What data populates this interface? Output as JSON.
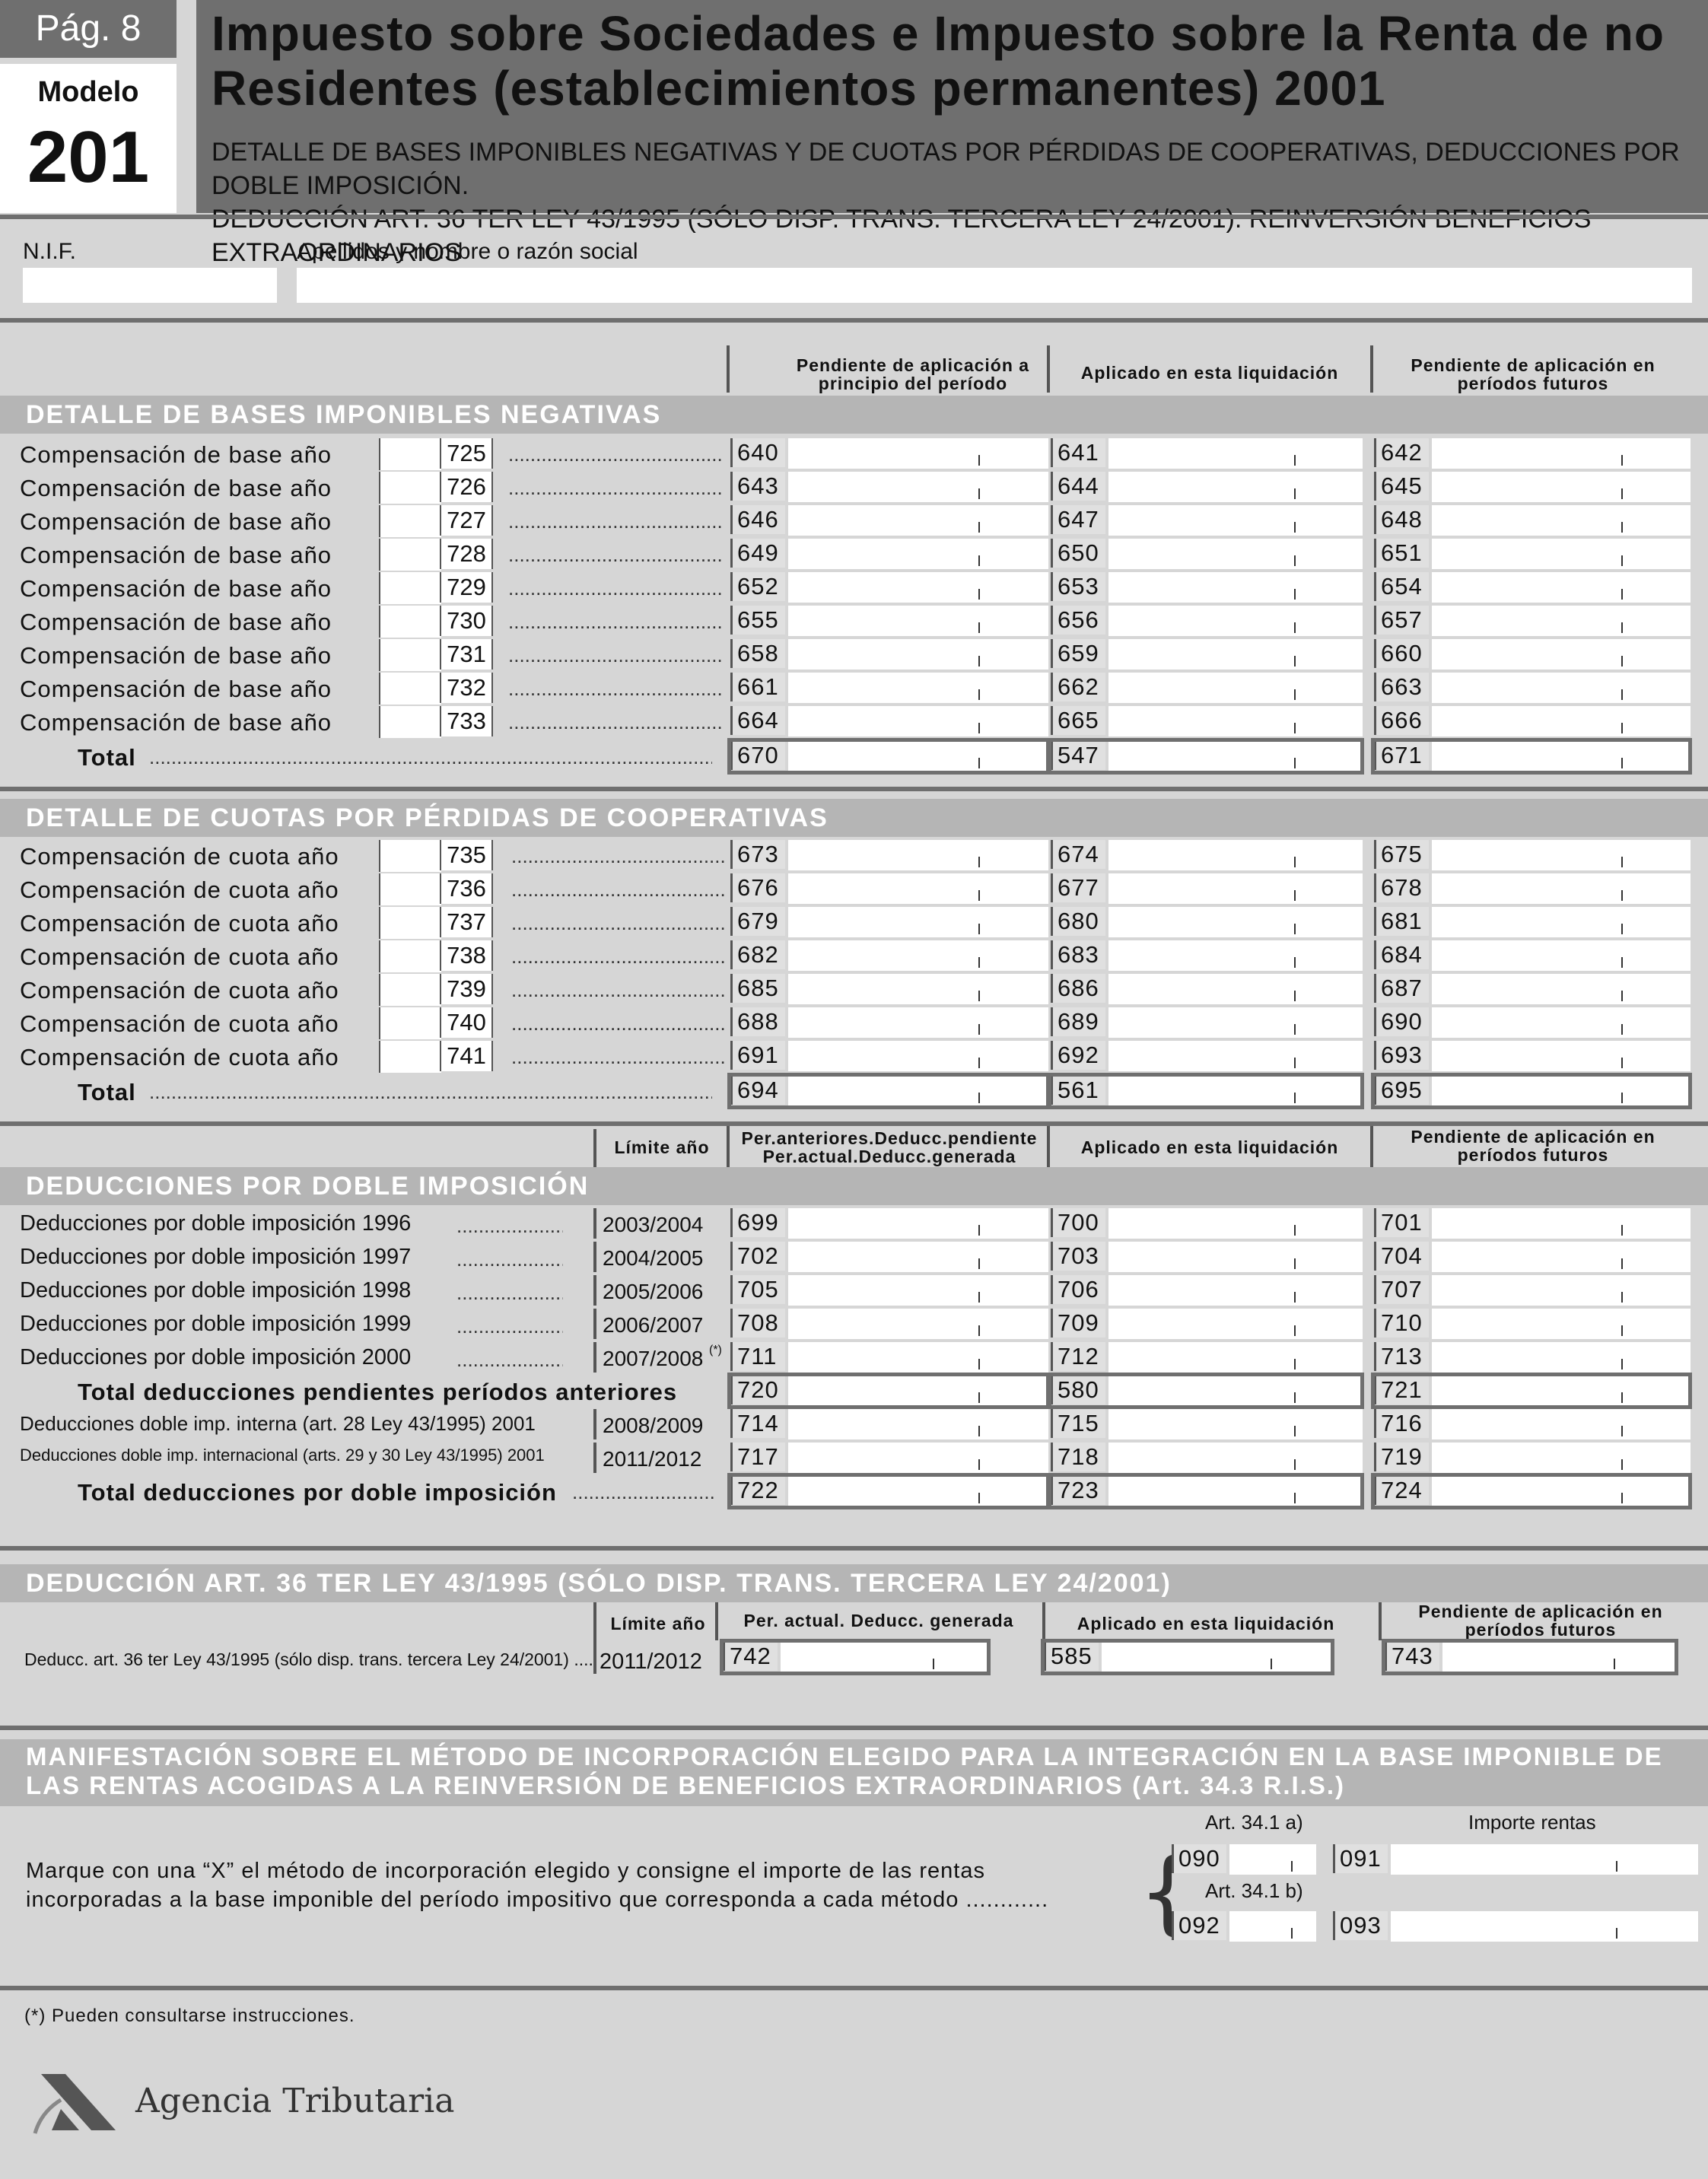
{
  "header": {
    "page": "Pág. 8",
    "modelo_label": "Modelo",
    "modelo_number": "201",
    "title_line1": "Impuesto sobre Sociedades e Impuesto sobre la Renta de no",
    "title_line2": "Residentes (establecimientos permanentes) 2001",
    "subtitle_line1": "DETALLE DE BASES IMPONIBLES NEGATIVAS Y DE CUOTAS POR PÉRDIDAS DE COOPERATIVAS, DEDUCCIONES POR DOBLE IMPOSICIÓN.",
    "subtitle_line2": "DEDUCCIÓN ART. 36 TER LEY 43/1995 (SÓLO DISP. TRANS. TERCERA LEY 24/2001). REINVERSIÓN BENEFICIOS EXTRAORDINARIOS"
  },
  "identity": {
    "nif_label": "N.I.F.",
    "name_label": "Apellidos y nombre o razón social"
  },
  "columns": {
    "col1": "Pendiente de aplicación a principio del período",
    "col2": "Aplicado en esta liquidación",
    "col3": "Pendiente de aplicación en períodos futuros",
    "col1_doble": "Per.anteriores.Deducc.pendiente Per.actual.Deducc.generada",
    "limite": "Límite año",
    "col1_art36": "Per. actual. Deducc. generada"
  },
  "bases": {
    "title": "DETALLE DE BASES IMPONIBLES NEGATIVAS",
    "rows": [
      {
        "label": "Compensación de base año",
        "year_code": "725",
        "c1": "640",
        "c2": "641",
        "c3": "642"
      },
      {
        "label": "Compensación de base año",
        "year_code": "726",
        "c1": "643",
        "c2": "644",
        "c3": "645"
      },
      {
        "label": "Compensación de base año",
        "year_code": "727",
        "c1": "646",
        "c2": "647",
        "c3": "648"
      },
      {
        "label": "Compensación de base año",
        "year_code": "728",
        "c1": "649",
        "c2": "650",
        "c3": "651"
      },
      {
        "label": "Compensación de base año",
        "year_code": "729",
        "c1": "652",
        "c2": "653",
        "c3": "654"
      },
      {
        "label": "Compensación de base año",
        "year_code": "730",
        "c1": "655",
        "c2": "656",
        "c3": "657"
      },
      {
        "label": "Compensación de base año",
        "year_code": "731",
        "c1": "658",
        "c2": "659",
        "c3": "660"
      },
      {
        "label": "Compensación de base año",
        "year_code": "732",
        "c1": "661",
        "c2": "662",
        "c3": "663"
      },
      {
        "label": "Compensación de base año",
        "year_code": "733",
        "c1": "664",
        "c2": "665",
        "c3": "666"
      }
    ],
    "total": {
      "label": "Total",
      "c1": "670",
      "c2": "547",
      "c3": "671"
    }
  },
  "cuotas": {
    "title": "DETALLE DE CUOTAS POR PÉRDIDAS DE COOPERATIVAS",
    "rows": [
      {
        "label": "Compensación de cuota año",
        "year_code": "735",
        "c1": "673",
        "c2": "674",
        "c3": "675"
      },
      {
        "label": "Compensación de cuota año",
        "year_code": "736",
        "c1": "676",
        "c2": "677",
        "c3": "678"
      },
      {
        "label": "Compensación de cuota año",
        "year_code": "737",
        "c1": "679",
        "c2": "680",
        "c3": "681"
      },
      {
        "label": "Compensación de cuota año",
        "year_code": "738",
        "c1": "682",
        "c2": "683",
        "c3": "684"
      },
      {
        "label": "Compensación de cuota año",
        "year_code": "739",
        "c1": "685",
        "c2": "686",
        "c3": "687"
      },
      {
        "label": "Compensación de cuota año",
        "year_code": "740",
        "c1": "688",
        "c2": "689",
        "c3": "690"
      },
      {
        "label": "Compensación de cuota año",
        "year_code": "741",
        "c1": "691",
        "c2": "692",
        "c3": "693"
      }
    ],
    "total": {
      "label": "Total",
      "c1": "694",
      "c2": "561",
      "c3": "695"
    }
  },
  "doble": {
    "title": "DEDUCCIONES POR DOBLE IMPOSICIÓN",
    "rows": [
      {
        "label": "Deducciones por doble imposición 1996",
        "limit": "2003/2004",
        "c1": "699",
        "c2": "700",
        "c3": "701"
      },
      {
        "label": "Deducciones por doble imposición 1997",
        "limit": "2004/2005",
        "c1": "702",
        "c2": "703",
        "c3": "704"
      },
      {
        "label": "Deducciones por doble imposición 1998",
        "limit": "2005/2006",
        "c1": "705",
        "c2": "706",
        "c3": "707"
      },
      {
        "label": "Deducciones por doble imposición 1999",
        "limit": "2006/2007",
        "c1": "708",
        "c2": "709",
        "c3": "710"
      },
      {
        "label": "Deducciones por doble imposición 2000",
        "limit": "2007/2008",
        "limit_note": "(*)",
        "c1": "711",
        "c2": "712",
        "c3": "713"
      }
    ],
    "subtotal": {
      "label": "Total deducciones pendientes períodos anteriores",
      "c1": "720",
      "c2": "580",
      "c3": "721"
    },
    "extra_rows": [
      {
        "label": "Deducciones doble imp. interna (art. 28 Ley 43/1995) 2001",
        "limit": "2008/2009",
        "c1": "714",
        "c2": "715",
        "c3": "716"
      },
      {
        "label": "Deducciones doble imp. internacional (arts. 29 y 30 Ley 43/1995) 2001",
        "limit": "2011/2012",
        "c1": "717",
        "c2": "718",
        "c3": "719"
      }
    ],
    "total": {
      "label": "Total deducciones por doble imposición",
      "c1": "722",
      "c2": "723",
      "c3": "724"
    }
  },
  "art36": {
    "title": "DEDUCCIÓN ART. 36 TER LEY 43/1995 (SÓLO DISP. TRANS. TERCERA LEY 24/2001)",
    "row_label": "Deducc. art. 36 ter Ley 43/1995 (sólo disp. trans. tercera Ley 24/2001) ....",
    "limit": "2011/2012",
    "c1": "742",
    "c2": "585",
    "c3": "743"
  },
  "manif": {
    "title_line1": "MANIFESTACIÓN SOBRE EL MÉTODO DE INCORPORACIÓN ELEGIDO PARA LA INTEGRACIÓN EN LA BASE IMPONIBLE DE",
    "title_line2": "LAS RENTAS ACOGIDAS A LA REINVERSIÓN DE BENEFICIOS EXTRAORDINARIOS (Art. 34.3 R.I.S.)",
    "text_line1": "Marque con una “X” el método de incorporación elegido y consigne el importe de las rentas",
    "text_line2": "incorporadas a la base imponible del período impositivo que corresponda a cada método",
    "art_a": "Art. 34.1 a)",
    "art_b": "Art. 34.1 b)",
    "importe": "Importe rentas",
    "codes": [
      "090",
      "091",
      "092",
      "093"
    ]
  },
  "footnote": "(*) Pueden consultarse instrucciones.",
  "agency": "Agencia Tributaria"
}
